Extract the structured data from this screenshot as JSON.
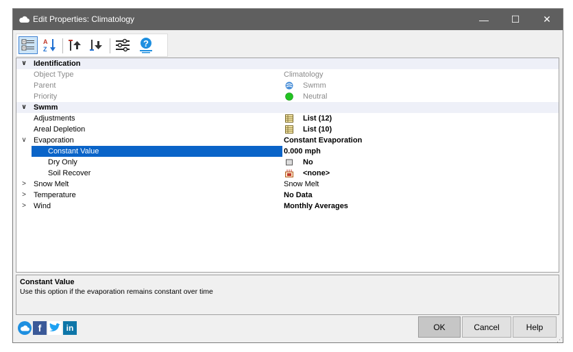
{
  "window": {
    "title": "Edit Properties: Climatology",
    "minimize": "—",
    "maximize": "☐",
    "close": "✕"
  },
  "toolbar": {
    "buttons": [
      "categorized-view",
      "alphabetical-sort",
      "move-up",
      "move-down",
      "settings",
      "help"
    ]
  },
  "grid": {
    "rows": [
      {
        "type": "category",
        "expander": "∨",
        "name": "Identification"
      },
      {
        "type": "prop",
        "name": "Object Type",
        "value": "Climatology",
        "muted": true
      },
      {
        "type": "prop",
        "name": "Parent",
        "value": "Swmm",
        "muted": true,
        "icon": "swmm-icon"
      },
      {
        "type": "prop",
        "name": "Priority",
        "value": "Neutral",
        "muted": true,
        "icon": "green-dot-icon"
      },
      {
        "type": "category",
        "expander": "∨",
        "name": "Swmm"
      },
      {
        "type": "prop",
        "name": "Adjustments",
        "value": "List (12)",
        "bold": true,
        "icon": "table-icon"
      },
      {
        "type": "prop",
        "name": "Areal Depletion",
        "value": "List (10)",
        "bold": true,
        "icon": "table-icon"
      },
      {
        "type": "prop",
        "expander": "∨",
        "name": "Evaporation",
        "value": "Constant Evaporation",
        "bold": true
      },
      {
        "type": "sub",
        "name": "Constant Value",
        "value": "0.000 mph",
        "bold": true,
        "selected": true
      },
      {
        "type": "sub",
        "name": "Dry Only",
        "value": "No",
        "bold": true,
        "icon": "checkbox-icon"
      },
      {
        "type": "sub",
        "name": "Soil Recover",
        "value": "<none>",
        "bold": true,
        "icon": "pattern-icon"
      },
      {
        "type": "prop",
        "expander": ">",
        "name": "Snow Melt",
        "value": "Snow Melt"
      },
      {
        "type": "prop",
        "expander": ">",
        "name": "Temperature",
        "value": "No Data",
        "bold": true
      },
      {
        "type": "prop",
        "expander": ">",
        "name": "Wind",
        "value": "Monthly Averages",
        "bold": true
      }
    ]
  },
  "description": {
    "title": "Constant Value",
    "text": "Use this option if the evaporation remains constant over time"
  },
  "social": {
    "facebook": "f",
    "linkedin": "in"
  },
  "buttons": {
    "ok": "OK",
    "cancel": "Cancel",
    "help": "Help"
  }
}
